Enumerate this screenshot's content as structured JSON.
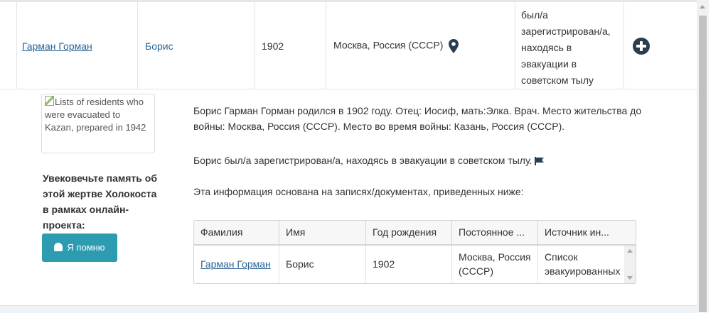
{
  "row": {
    "surname": "Гарман Горман",
    "first_name": "Борис",
    "birth_year": "1902",
    "residence": "Москва, Россия (СССР)",
    "status": "был/а зарегистрирован/а, находясь в эвакуации в советском тылу"
  },
  "image_alt": "Lists of residents who were evacuated to Kazan, prepared in 1942",
  "memory_prompt": "Увековечьте память об этой жертве Холокоста в рамках онлайн-проекта:",
  "remember_button": "Я помню",
  "description": {
    "paragraph1": "Борис Гарман Горман родился в 1902 году. Отец: Иосиф, мать:Элка. Врач. Место жительства до войны: Москва, Россия (СССР). Место во время войны: Казань, Россия (СССР).",
    "paragraph2": "Борис был/а зарегистрирован/а, находясь в эвакуации в советском тылу.",
    "paragraph3": "Эта информация основана на записях/документах, приведенных ниже:"
  },
  "sources_table": {
    "headers": [
      "Фамилия",
      "Имя",
      "Год рождения",
      "Постоянное ...",
      "Источник ин..."
    ],
    "row": {
      "surname": "Гарман Горман",
      "first_name": "Борис",
      "birth_year": "1902",
      "residence": "Москва, Россия (СССР)",
      "source": "Список эвакуированных"
    }
  },
  "icons": {
    "location": "map-marker-icon",
    "expand": "plus-circle-icon",
    "flag": "flag-icon",
    "user_add": "user-plus-icon"
  },
  "colors": {
    "link": "#2a6496",
    "button": "#2d9cb0",
    "plus_icon": "#2b3e50"
  }
}
